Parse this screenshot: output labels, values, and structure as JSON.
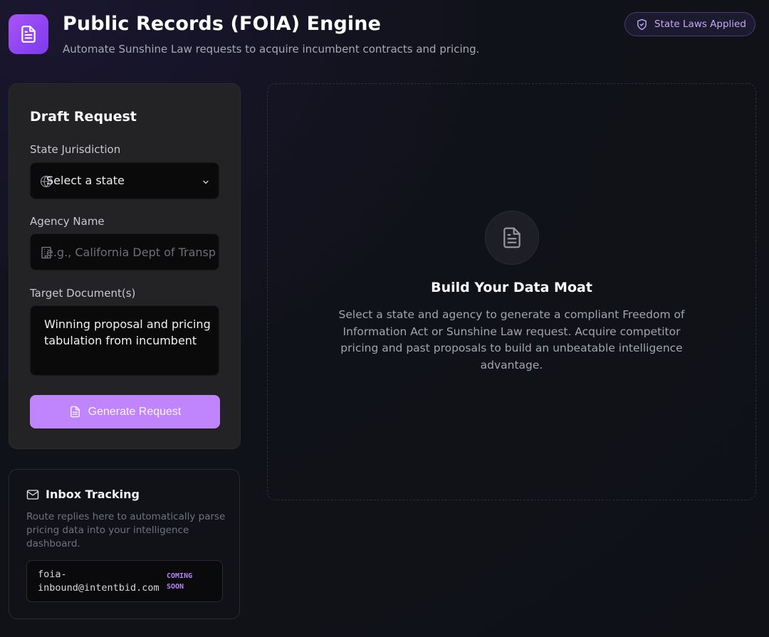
{
  "header": {
    "title": "Public Records (FOIA) Engine",
    "subtitle": "Automate Sunshine Law requests to acquire incumbent contracts and pricing.",
    "badge_label": "State Laws Applied",
    "app_icon": "document-icon"
  },
  "draft": {
    "title": "Draft Request",
    "state_label": "State Jurisdiction",
    "state_value": "Select a state",
    "agency_label": "Agency Name",
    "agency_placeholder": "e.g., California Dept of Transp",
    "doc_label": "Target Document(s)",
    "doc_value": "Winning proposal and pricing tabulation from incumbent",
    "generate_label": "Generate Request"
  },
  "inbox": {
    "title": "Inbox Tracking",
    "description": "Route replies here to automatically parse pricing data into your intelligence dashboard.",
    "email": "foia-inbound@intentbid.com",
    "status": "COMING SOON"
  },
  "empty_state": {
    "title": "Build Your Data Moat",
    "description": "Select a state and agency to generate a compliant Freedom of Information Act or Sunshine Law request. Acquire competitor pricing and past proposals to build an unbeatable intelligence advantage."
  },
  "colors": {
    "accent": "#c084fc",
    "brand_gradient_start": "#a855f7",
    "brand_gradient_end": "#7c3aed",
    "background": "#0f1117",
    "card": "#232325"
  }
}
